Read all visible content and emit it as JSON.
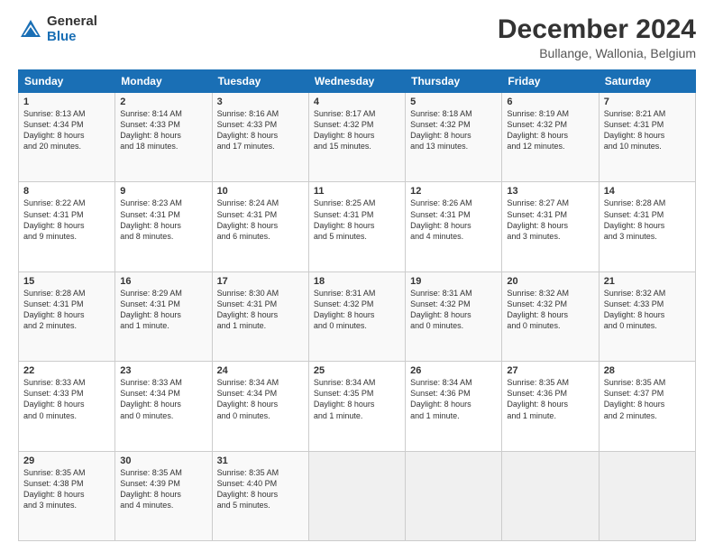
{
  "logo": {
    "general": "General",
    "blue": "Blue"
  },
  "header": {
    "title": "December 2024",
    "subtitle": "Bullange, Wallonia, Belgium"
  },
  "weekdays": [
    "Sunday",
    "Monday",
    "Tuesday",
    "Wednesday",
    "Thursday",
    "Friday",
    "Saturday"
  ],
  "weeks": [
    [
      {
        "day": "1",
        "info": "Sunrise: 8:13 AM\nSunset: 4:34 PM\nDaylight: 8 hours\nand 20 minutes."
      },
      {
        "day": "2",
        "info": "Sunrise: 8:14 AM\nSunset: 4:33 PM\nDaylight: 8 hours\nand 18 minutes."
      },
      {
        "day": "3",
        "info": "Sunrise: 8:16 AM\nSunset: 4:33 PM\nDaylight: 8 hours\nand 17 minutes."
      },
      {
        "day": "4",
        "info": "Sunrise: 8:17 AM\nSunset: 4:32 PM\nDaylight: 8 hours\nand 15 minutes."
      },
      {
        "day": "5",
        "info": "Sunrise: 8:18 AM\nSunset: 4:32 PM\nDaylight: 8 hours\nand 13 minutes."
      },
      {
        "day": "6",
        "info": "Sunrise: 8:19 AM\nSunset: 4:32 PM\nDaylight: 8 hours\nand 12 minutes."
      },
      {
        "day": "7",
        "info": "Sunrise: 8:21 AM\nSunset: 4:31 PM\nDaylight: 8 hours\nand 10 minutes."
      }
    ],
    [
      {
        "day": "8",
        "info": "Sunrise: 8:22 AM\nSunset: 4:31 PM\nDaylight: 8 hours\nand 9 minutes."
      },
      {
        "day": "9",
        "info": "Sunrise: 8:23 AM\nSunset: 4:31 PM\nDaylight: 8 hours\nand 8 minutes."
      },
      {
        "day": "10",
        "info": "Sunrise: 8:24 AM\nSunset: 4:31 PM\nDaylight: 8 hours\nand 6 minutes."
      },
      {
        "day": "11",
        "info": "Sunrise: 8:25 AM\nSunset: 4:31 PM\nDaylight: 8 hours\nand 5 minutes."
      },
      {
        "day": "12",
        "info": "Sunrise: 8:26 AM\nSunset: 4:31 PM\nDaylight: 8 hours\nand 4 minutes."
      },
      {
        "day": "13",
        "info": "Sunrise: 8:27 AM\nSunset: 4:31 PM\nDaylight: 8 hours\nand 3 minutes."
      },
      {
        "day": "14",
        "info": "Sunrise: 8:28 AM\nSunset: 4:31 PM\nDaylight: 8 hours\nand 3 minutes."
      }
    ],
    [
      {
        "day": "15",
        "info": "Sunrise: 8:28 AM\nSunset: 4:31 PM\nDaylight: 8 hours\nand 2 minutes."
      },
      {
        "day": "16",
        "info": "Sunrise: 8:29 AM\nSunset: 4:31 PM\nDaylight: 8 hours\nand 1 minute."
      },
      {
        "day": "17",
        "info": "Sunrise: 8:30 AM\nSunset: 4:31 PM\nDaylight: 8 hours\nand 1 minute."
      },
      {
        "day": "18",
        "info": "Sunrise: 8:31 AM\nSunset: 4:32 PM\nDaylight: 8 hours\nand 0 minutes."
      },
      {
        "day": "19",
        "info": "Sunrise: 8:31 AM\nSunset: 4:32 PM\nDaylight: 8 hours\nand 0 minutes."
      },
      {
        "day": "20",
        "info": "Sunrise: 8:32 AM\nSunset: 4:32 PM\nDaylight: 8 hours\nand 0 minutes."
      },
      {
        "day": "21",
        "info": "Sunrise: 8:32 AM\nSunset: 4:33 PM\nDaylight: 8 hours\nand 0 minutes."
      }
    ],
    [
      {
        "day": "22",
        "info": "Sunrise: 8:33 AM\nSunset: 4:33 PM\nDaylight: 8 hours\nand 0 minutes."
      },
      {
        "day": "23",
        "info": "Sunrise: 8:33 AM\nSunset: 4:34 PM\nDaylight: 8 hours\nand 0 minutes."
      },
      {
        "day": "24",
        "info": "Sunrise: 8:34 AM\nSunset: 4:34 PM\nDaylight: 8 hours\nand 0 minutes."
      },
      {
        "day": "25",
        "info": "Sunrise: 8:34 AM\nSunset: 4:35 PM\nDaylight: 8 hours\nand 1 minute."
      },
      {
        "day": "26",
        "info": "Sunrise: 8:34 AM\nSunset: 4:36 PM\nDaylight: 8 hours\nand 1 minute."
      },
      {
        "day": "27",
        "info": "Sunrise: 8:35 AM\nSunset: 4:36 PM\nDaylight: 8 hours\nand 1 minute."
      },
      {
        "day": "28",
        "info": "Sunrise: 8:35 AM\nSunset: 4:37 PM\nDaylight: 8 hours\nand 2 minutes."
      }
    ],
    [
      {
        "day": "29",
        "info": "Sunrise: 8:35 AM\nSunset: 4:38 PM\nDaylight: 8 hours\nand 3 minutes."
      },
      {
        "day": "30",
        "info": "Sunrise: 8:35 AM\nSunset: 4:39 PM\nDaylight: 8 hours\nand 4 minutes."
      },
      {
        "day": "31",
        "info": "Sunrise: 8:35 AM\nSunset: 4:40 PM\nDaylight: 8 hours\nand 5 minutes."
      },
      {
        "day": "",
        "info": ""
      },
      {
        "day": "",
        "info": ""
      },
      {
        "day": "",
        "info": ""
      },
      {
        "day": "",
        "info": ""
      }
    ]
  ]
}
